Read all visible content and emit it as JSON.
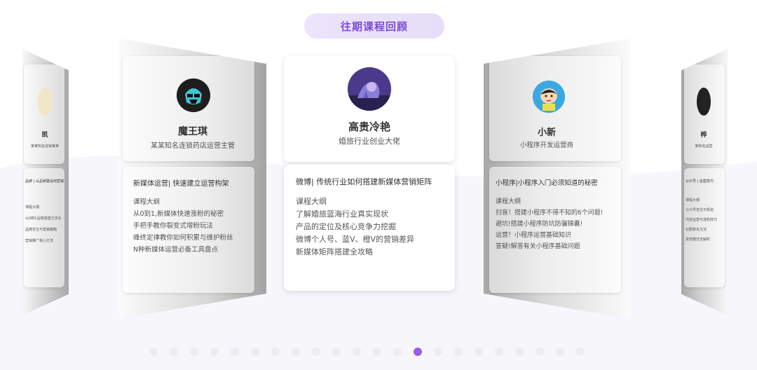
{
  "section_title": "往期课程回顾",
  "cards": {
    "far_left": {
      "name": "凯",
      "role": "某某知名连锁某某",
      "course": "品牌 | 从品牌建设到营销",
      "lines": [
        "课程大纲",
        "从0到1品牌搭建方法论",
        "品牌定位与营销策略",
        "营销推广核心打法"
      ]
    },
    "left": {
      "name": "魔王琪",
      "role": "某某知名连锁药店运营主管",
      "course": "新媒体运营| 快速建立运营构架",
      "lines": [
        "课程大纲",
        "从0到1,新媒体快速涨粉的秘密",
        "手把手教你裂变式增粉玩法",
        "峰终定律教你如何积累与维护粉丝",
        "N种新媒体运营必备工具盘点"
      ]
    },
    "center": {
      "name": "高贵冷艳",
      "role": "婚旅行业创业大佬",
      "course": "微博| 传统行业如何搭建新媒体营销矩阵",
      "lines": [
        "课程大纲",
        "了解婚旅蓝海行业真实现状",
        "产品的定位及核心竞争力挖掘",
        "微博个人号、蓝V、橙V的营销差异",
        "新媒体矩阵搭建全攻略"
      ]
    },
    "right": {
      "name": "小新",
      "role": "小程序开发运营商",
      "course": "小程序|小程序入门必须知道的秘密",
      "lines": [
        "课程大纲",
        "扫盲！搭建小程序不得不知的6个问题!",
        "避坑!搭建小程序防坑防骗锦囊!",
        "运营！小程序运营基础知识",
        "答疑!解答有关小程序基础问题"
      ]
    },
    "far_right": {
      "name": "桦",
      "role": "某知名运营",
      "course": "公众号 | 运营技巧",
      "lines": [
        "课程大纲",
        "公众号定位与规划",
        "内容运营与涨粉技巧",
        "社群转化方法",
        "变现模式全解析"
      ]
    }
  },
  "pagination": {
    "total": 22,
    "active_index": 13
  },
  "colors": {
    "accent": "#9b5de5",
    "title_text": "#7a4cd6"
  }
}
